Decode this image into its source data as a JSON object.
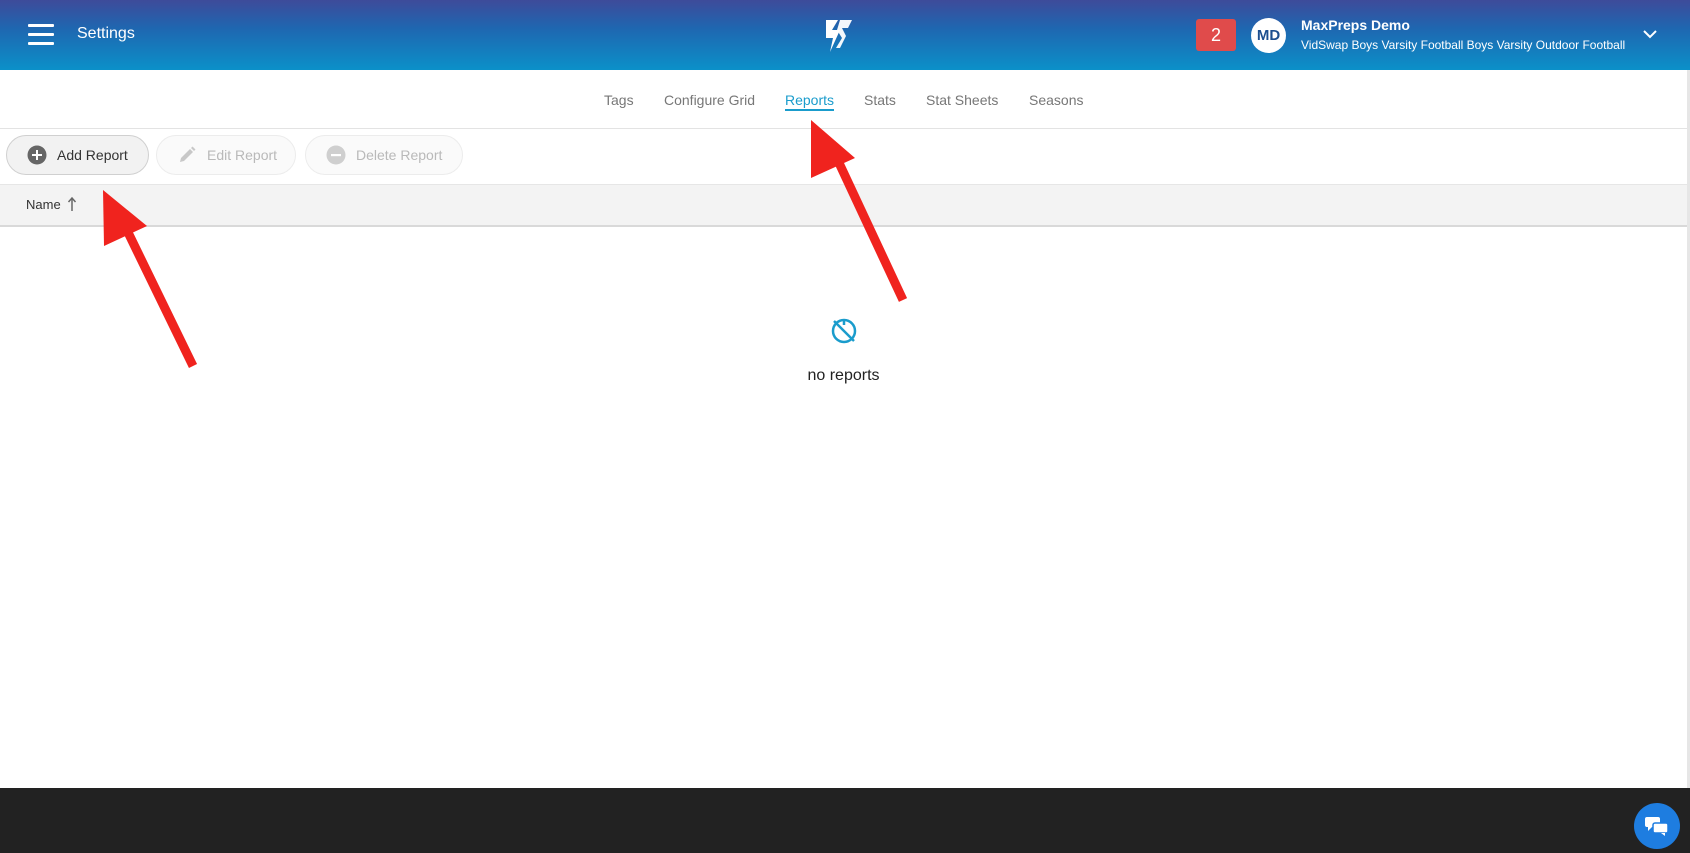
{
  "header": {
    "title": "Settings",
    "notification_count": "2",
    "avatar_initials": "MD",
    "user_name": "MaxPreps Demo",
    "team_name": "VidSwap Boys Varsity Football Boys Varsity Outdoor Football",
    "icons": {
      "menu": "hamburger-icon",
      "logo": "vidswap-logo",
      "chevron": "chevron-down-icon"
    }
  },
  "tabs": [
    {
      "label": "Tags",
      "active": false
    },
    {
      "label": "Configure Grid",
      "active": false
    },
    {
      "label": "Reports",
      "active": true
    },
    {
      "label": "Stats",
      "active": false
    },
    {
      "label": "Stat Sheets",
      "active": false
    },
    {
      "label": "Seasons",
      "active": false
    }
  ],
  "toolbar": {
    "add_label": "Add Report",
    "edit_label": "Edit Report",
    "delete_label": "Delete Report",
    "edit_disabled": true,
    "delete_disabled": true
  },
  "table": {
    "column_name": "Name",
    "sort": "ascending"
  },
  "empty_state": {
    "icon": "no-data-icon",
    "text": "no reports"
  },
  "colors": {
    "accent": "#1a9ccc",
    "badge": "#e04b4b",
    "annotation_arrow": "#f0231e",
    "footer": "#222222",
    "chat_button": "#1e7de0"
  }
}
